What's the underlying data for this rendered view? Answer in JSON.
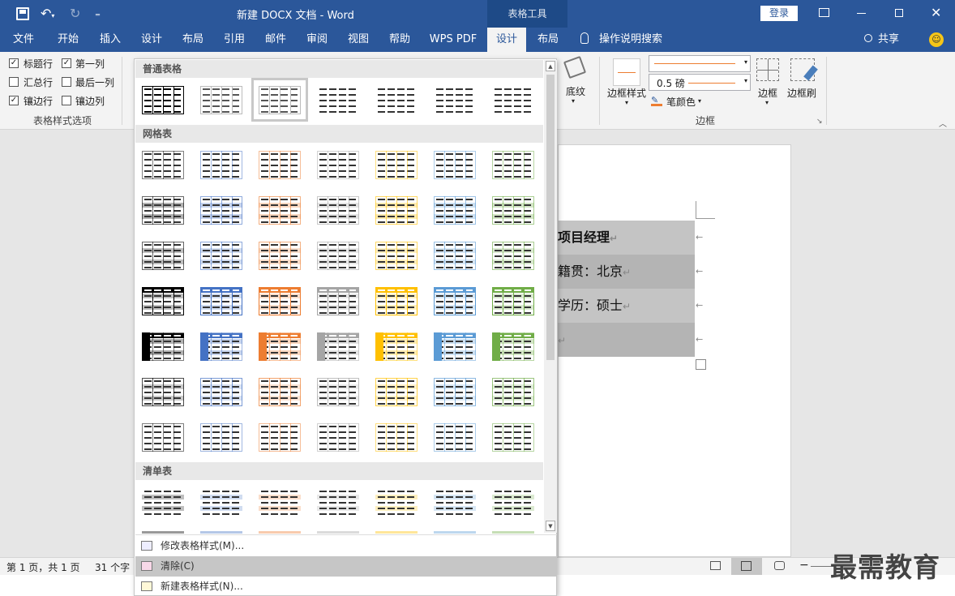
{
  "titlebar": {
    "title": "新建 DOCX 文档  -  Word",
    "context_tab": "表格工具",
    "login": "登录"
  },
  "tabs": [
    "文件",
    "开始",
    "插入",
    "设计",
    "布局",
    "引用",
    "邮件",
    "审阅",
    "视图",
    "帮助",
    "WPS PDF",
    "设计",
    "布局"
  ],
  "tellme": "操作说明搜索",
  "share": "共享",
  "style_options": {
    "header_row": "标题行",
    "first_column": "第一列",
    "total_row": "汇总行",
    "last_column": "最后一列",
    "banded_rows": "镶边行",
    "banded_columns": "镶边列",
    "group_label": "表格样式选项",
    "checked": {
      "header_row": true,
      "first_column": true,
      "total_row": false,
      "last_column": false,
      "banded_rows": true,
      "banded_columns": false
    }
  },
  "borders": {
    "shading": "底纹",
    "border_styles": "边框样式",
    "pen_weight": "0.5 磅",
    "pen_color": "笔颜色",
    "border": "边框",
    "border_painter": "边框刷",
    "group_label": "边框"
  },
  "gallery": {
    "sections": [
      "普通表格",
      "网格表",
      "清单表"
    ],
    "grid_colors": [
      "#000000",
      "#4472c4",
      "#ed7d31",
      "#a5a5a5",
      "#ffc000",
      "#5b9bd5",
      "#70ad47"
    ],
    "menu": {
      "modify": "修改表格样式(M)...",
      "clear": "清除(C)",
      "new": "新建表格样式(N)..."
    }
  },
  "document": {
    "rows": [
      "项目经理",
      "籍贯：北京",
      "学历：硕士",
      ""
    ]
  },
  "statusbar": {
    "page": "第 1 页，共 1 页",
    "words": "31 个字"
  },
  "watermark": "最需教育"
}
